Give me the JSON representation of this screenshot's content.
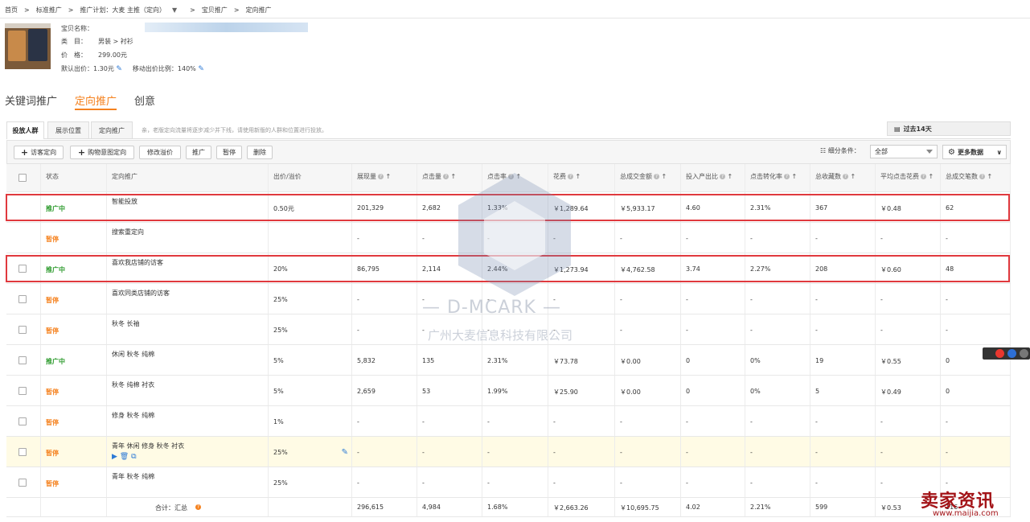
{
  "breadcrumb": [
    "首页",
    "标准推广",
    "推广计划：大麦 主推（定向）",
    "宝贝推广",
    "定向推广"
  ],
  "product": {
    "name_label": "宝贝名称：",
    "category_label": "类　目：",
    "category_value": "男装 > 衬衫",
    "price_label": "价　格：",
    "price_value": "299.00元",
    "default_bid_label": "默认出价：",
    "default_bid_value": "1.30元",
    "mobile_ratio_label": "移动出价比例：",
    "mobile_ratio_value": "140%"
  },
  "main_tabs": [
    "关键词推广",
    "定向推广",
    "创意"
  ],
  "sub_tabs": [
    "投放人群",
    "展示位置",
    "定向推广"
  ],
  "sub_tip": "亲，老版定向流量将逐步减少并下线，请使用新版的人群和位置进行投放。",
  "date_range_label": "过去14天",
  "toolbar": {
    "add_visitor": "访客定向",
    "add_shopping": "购物意图定向",
    "modify_bid": "修改溢价",
    "promote": "推广",
    "pause": "暂停",
    "delete": "删除",
    "filter_label": "细分条件：",
    "filter_value": "全部",
    "more_data": "更多数据"
  },
  "columns": [
    "状态",
    "定向推广",
    "出价/溢价",
    "展现量",
    "点击量",
    "点击率",
    "花费",
    "总成交金额",
    "投入产出比",
    "点击转化率",
    "总收藏数",
    "平均点击花费",
    "总成交笔数"
  ],
  "rows": [
    {
      "status": "推广中",
      "name": "智能投放",
      "bid": "0.50元",
      "impr": "201,329",
      "clicks": "2,682",
      "ctr": "1.33%",
      "cost": "￥1,289.64",
      "gmv": "￥5,933.17",
      "roi": "4.60",
      "cvr": "2.31%",
      "fav": "367",
      "cpc": "￥0.48",
      "orders": "62"
    },
    {
      "status": "暂停",
      "name": "搜索重定向",
      "bid": "",
      "impr": "-",
      "clicks": "-",
      "ctr": "-",
      "cost": "-",
      "gmv": "-",
      "roi": "-",
      "cvr": "-",
      "fav": "-",
      "cpc": "-",
      "orders": "-"
    },
    {
      "status": "推广中",
      "name": "喜欢我店铺的访客",
      "bid": "20%",
      "impr": "86,795",
      "clicks": "2,114",
      "ctr": "2.44%",
      "cost": "￥1,273.94",
      "gmv": "￥4,762.58",
      "roi": "3.74",
      "cvr": "2.27%",
      "fav": "208",
      "cpc": "￥0.60",
      "orders": "48"
    },
    {
      "status": "暂停",
      "name": "喜欢同类店铺的访客",
      "bid": "25%",
      "impr": "-",
      "clicks": "-",
      "ctr": "-",
      "cost": "-",
      "gmv": "-",
      "roi": "-",
      "cvr": "-",
      "fav": "-",
      "cpc": "-",
      "orders": "-"
    },
    {
      "status": "暂停",
      "name": "秋冬 长袖",
      "bid": "25%",
      "impr": "-",
      "clicks": "-",
      "ctr": "-",
      "cost": "-",
      "gmv": "-",
      "roi": "-",
      "cvr": "-",
      "fav": "-",
      "cpc": "-",
      "orders": "-"
    },
    {
      "status": "推广中",
      "name": "休闲 秋冬 纯棉",
      "bid": "5%",
      "impr": "5,832",
      "clicks": "135",
      "ctr": "2.31%",
      "cost": "￥73.78",
      "gmv": "￥0.00",
      "roi": "0",
      "cvr": "0%",
      "fav": "19",
      "cpc": "￥0.55",
      "orders": "0"
    },
    {
      "status": "暂停",
      "name": "秋冬 纯棉 衬衣",
      "bid": "5%",
      "impr": "2,659",
      "clicks": "53",
      "ctr": "1.99%",
      "cost": "￥25.90",
      "gmv": "￥0.00",
      "roi": "0",
      "cvr": "0%",
      "fav": "5",
      "cpc": "￥0.49",
      "orders": "0"
    },
    {
      "status": "暂停",
      "name": "修身 秋冬 纯棉",
      "bid": "1%",
      "impr": "-",
      "clicks": "-",
      "ctr": "-",
      "cost": "-",
      "gmv": "-",
      "roi": "-",
      "cvr": "-",
      "fav": "-",
      "cpc": "-",
      "orders": "-"
    },
    {
      "status": "暂停",
      "name": "青年 休闲 修身 秋冬 衬衣",
      "bid": "25%",
      "impr": "-",
      "clicks": "-",
      "ctr": "-",
      "cost": "-",
      "gmv": "-",
      "roi": "-",
      "cvr": "-",
      "fav": "-",
      "cpc": "-",
      "orders": "-"
    },
    {
      "status": "暂停",
      "name": "青年 秋冬 纯棉",
      "bid": "25%",
      "impr": "-",
      "clicks": "-",
      "ctr": "-",
      "cost": "-",
      "gmv": "-",
      "roi": "-",
      "cvr": "-",
      "fav": "-",
      "cpc": "-",
      "orders": "-"
    }
  ],
  "totals": {
    "label": "合计：汇总",
    "impr": "296,615",
    "clicks": "4,984",
    "ctr": "1.68%",
    "cost": "￥2,663.26",
    "gmv": "￥10,695.75",
    "roi": "4.02",
    "cvr": "2.21%",
    "fav": "599",
    "cpc": "￥0.53",
    "orders": "116"
  },
  "watermark": {
    "title": "— D-MCARK —",
    "company": "广州大麦信息科技有限公司"
  },
  "brand": {
    "name": "卖家资讯",
    "url": "www.maijia.com"
  },
  "colors": {
    "accent": "#f5821f",
    "running": "#2e9b2e",
    "highlight_box": "#e0393e",
    "link": "#2d7ad6"
  }
}
